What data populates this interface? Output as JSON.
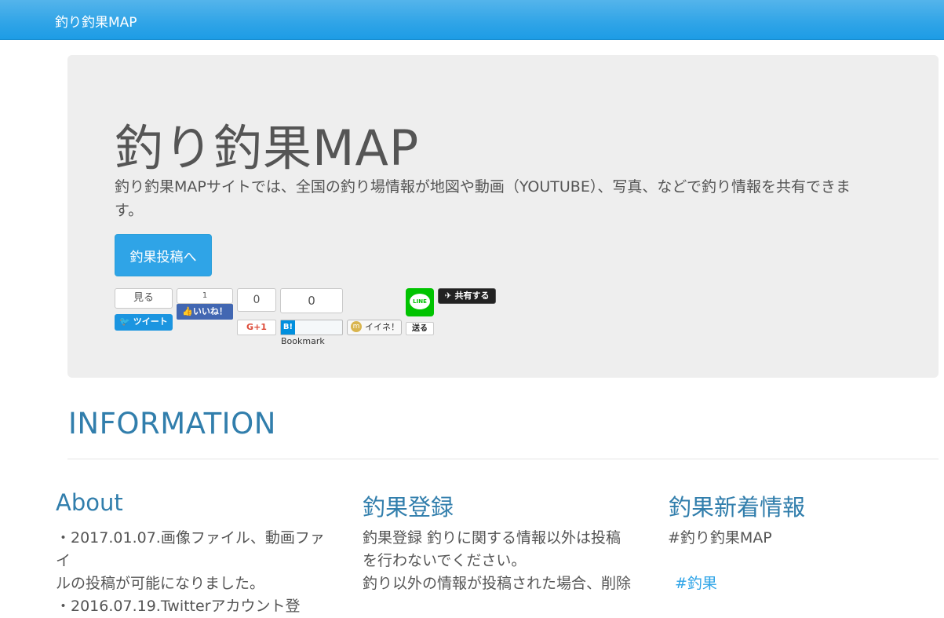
{
  "navbar": {
    "brand": "釣り釣果MAP"
  },
  "jumbotron": {
    "title": "釣り釣果MAP",
    "description": "釣り釣果MAPサイトでは、全国の釣り場情報が地図や動画（YOUTUBE）、写真、などで釣り情報を共有できます。",
    "button_label": "釣果投稿へ"
  },
  "social": {
    "twitter": {
      "count_label": "見る",
      "button_label": "ツイート"
    },
    "facebook": {
      "count": "1",
      "button_label": "いいね！"
    },
    "gplus": {
      "count": "0",
      "button_label": "G+1"
    },
    "hatena": {
      "count": "0",
      "button_label": "Bookmark",
      "icon_label": "B!"
    },
    "mixi": {
      "button_label": "イイネ！",
      "icon_label": "m"
    },
    "line": {
      "icon_label": "LINE",
      "button_label": "送る"
    },
    "share": {
      "button_label": "共有する"
    }
  },
  "information": {
    "title": "INFORMATION",
    "columns": [
      {
        "title": "About",
        "lines": [
          "・2017.01.07.画像ファイル、動画ファイ",
          "ルの投稿が可能になりました。",
          "・2016.07.19.Twitterアカウント登"
        ]
      },
      {
        "title": "釣果登録",
        "lines": [
          "釣果登録 釣りに関する情報以外は投稿",
          "を行わないでください。",
          "釣り以外の情報が投稿された場合、削除"
        ]
      },
      {
        "title": "釣果新着情報",
        "lines": [
          "#釣り釣果MAP"
        ],
        "link": "#釣果"
      }
    ]
  },
  "colors": {
    "navbar": "#2fa4e7",
    "heading": "#317eac",
    "jumbotron_bg": "#eeeeee"
  }
}
